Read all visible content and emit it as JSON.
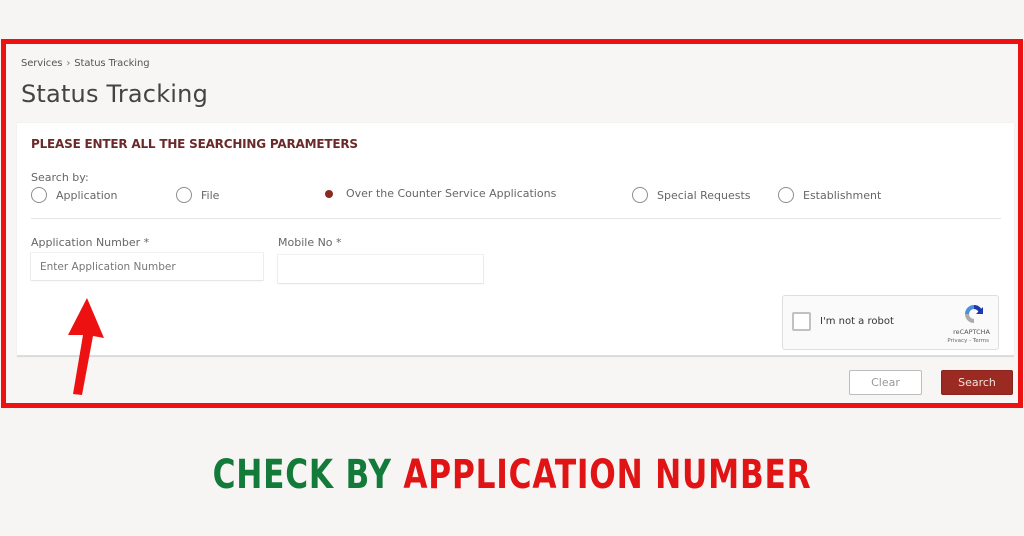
{
  "breadcrumb": {
    "items": [
      "Services",
      "Status Tracking"
    ],
    "separator": "›"
  },
  "page": {
    "title": "Status Tracking"
  },
  "form": {
    "heading": "PLEASE ENTER ALL THE SEARCHING PARAMETERS",
    "search_by_label": "Search by:",
    "search_options": [
      {
        "label": "Application",
        "selected": false
      },
      {
        "label": "File",
        "selected": false
      },
      {
        "label": "Over the Counter Service Applications",
        "selected": true
      },
      {
        "label": "Special Requests",
        "selected": false
      },
      {
        "label": "Establishment",
        "selected": false
      }
    ],
    "application_number": {
      "label": "Application Number *",
      "placeholder": "Enter Application Number",
      "value": ""
    },
    "mobile_no": {
      "label": "Mobile No *",
      "placeholder": "",
      "value": ""
    },
    "captcha": {
      "text": "I'm not a robot",
      "brand": "reCAPTCHA",
      "links": "Privacy - Terms",
      "checked": false
    }
  },
  "actions": {
    "clear_label": "Clear",
    "search_label": "Search"
  },
  "banner": {
    "part1": "CHECK BY",
    "part2": "APPLICATION NUMBER"
  },
  "colors": {
    "frame": "#ee1111",
    "accent": "#9b2b22",
    "banner_green": "#137a3a",
    "banner_red": "#e01414"
  }
}
